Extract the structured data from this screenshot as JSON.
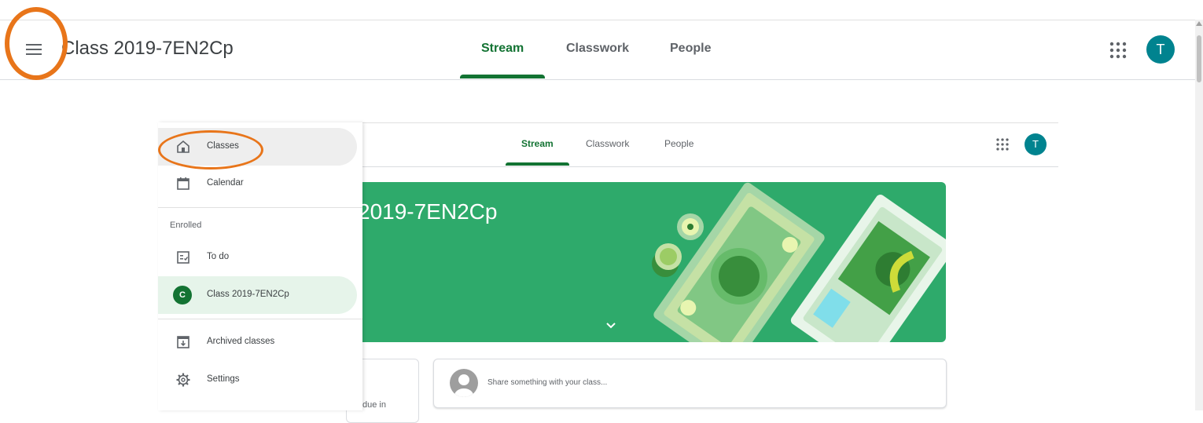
{
  "topbar": {
    "title": "Class 2019-7EN2Cp",
    "tabs": [
      {
        "label": "Stream",
        "active": true
      },
      {
        "label": "Classwork",
        "active": false
      },
      {
        "label": "People",
        "active": false
      }
    ],
    "avatar_letter": "T",
    "icons": {
      "menu": "hamburger-menu-icon",
      "apps": "apps-grid-icon"
    }
  },
  "inner": {
    "tabs": [
      {
        "label": "Stream",
        "active": true
      },
      {
        "label": "Classwork",
        "active": false
      },
      {
        "label": "People",
        "active": false
      }
    ],
    "avatar_letter": "T",
    "banner_title": "2019-7EN2Cp",
    "upcoming_text": "due in",
    "share_placeholder": "Share something with your class..."
  },
  "drawer": {
    "items": [
      {
        "label": "Classes",
        "icon": "home-icon"
      },
      {
        "label": "Calendar",
        "icon": "calendar-icon"
      },
      {
        "label": "To do",
        "icon": "todo-list-icon"
      },
      {
        "label": "Class 2019-7EN2Cp",
        "badge": "C"
      },
      {
        "label": "Archived classes",
        "icon": "archive-icon"
      },
      {
        "label": "Settings",
        "icon": "settings-gear-icon"
      }
    ],
    "section_label": "Enrolled"
  },
  "colors": {
    "accent_green": "#137333",
    "banner_green": "#2eaa6b",
    "avatar_teal": "#00838f",
    "annotation_orange": "#e8751a"
  }
}
